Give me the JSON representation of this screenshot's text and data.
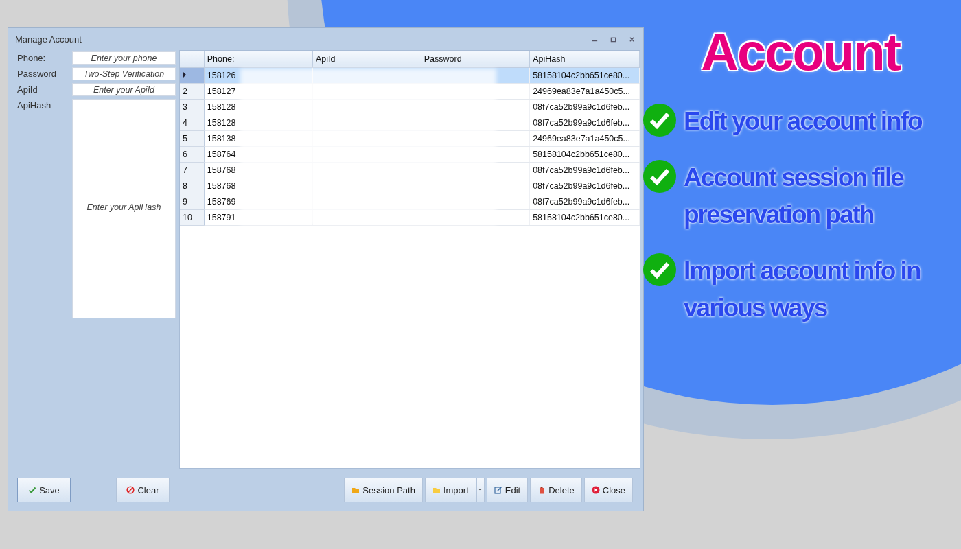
{
  "window": {
    "title": "Manage Account"
  },
  "form": {
    "fields": [
      {
        "label": "Phone:",
        "placeholder": "Enter your phone",
        "kind": "line"
      },
      {
        "label": "Password",
        "placeholder": "Two-Step Verification",
        "kind": "line"
      },
      {
        "label": "ApiId",
        "placeholder": "Enter your ApiId",
        "kind": "line"
      },
      {
        "label": "ApiHash",
        "placeholder": "Enter your ApiHash",
        "kind": "area"
      }
    ]
  },
  "table": {
    "columns": [
      "Phone:",
      "ApiId",
      "Password",
      "ApiHash"
    ],
    "rows": [
      {
        "header": "",
        "selected": true,
        "cells": [
          "158126",
          "",
          "",
          "58158104c2bb651ce80..."
        ]
      },
      {
        "header": "2",
        "selected": false,
        "cells": [
          "158127",
          "",
          "",
          "24969ea83e7a1a450c5..."
        ]
      },
      {
        "header": "3",
        "selected": false,
        "cells": [
          "158128",
          "",
          "",
          "08f7ca52b99a9c1d6feb..."
        ]
      },
      {
        "header": "4",
        "selected": false,
        "cells": [
          "158128",
          "",
          "",
          "08f7ca52b99a9c1d6feb..."
        ]
      },
      {
        "header": "5",
        "selected": false,
        "cells": [
          "158138",
          "",
          "",
          "24969ea83e7a1a450c5..."
        ]
      },
      {
        "header": "6",
        "selected": false,
        "cells": [
          "158764",
          "",
          "",
          "58158104c2bb651ce80..."
        ]
      },
      {
        "header": "7",
        "selected": false,
        "cells": [
          "158768",
          "",
          "",
          "08f7ca52b99a9c1d6feb..."
        ]
      },
      {
        "header": "8",
        "selected": false,
        "cells": [
          "158768",
          "",
          "",
          "08f7ca52b99a9c1d6feb..."
        ]
      },
      {
        "header": "9",
        "selected": false,
        "cells": [
          "158769",
          "",
          "",
          "08f7ca52b99a9c1d6feb..."
        ]
      },
      {
        "header": "10",
        "selected": false,
        "cells": [
          "158791",
          "",
          "",
          "58158104c2bb651ce80..."
        ]
      }
    ]
  },
  "left_buttons": [
    {
      "label": "Save",
      "kind": "check"
    },
    {
      "label": "Clear",
      "kind": "ban"
    }
  ],
  "right_buttons": [
    {
      "label": "Session Path",
      "kind": "folder"
    },
    {
      "label": "Import",
      "kind": "import"
    },
    {
      "label": "Edit",
      "kind": "edit"
    },
    {
      "label": "Delete",
      "kind": "delete"
    },
    {
      "label": "Close",
      "kind": "close"
    }
  ],
  "promo": {
    "title": "Account",
    "features": [
      "Edit your account info",
      "Account session file preservation path",
      "Import account info in various ways"
    ]
  }
}
